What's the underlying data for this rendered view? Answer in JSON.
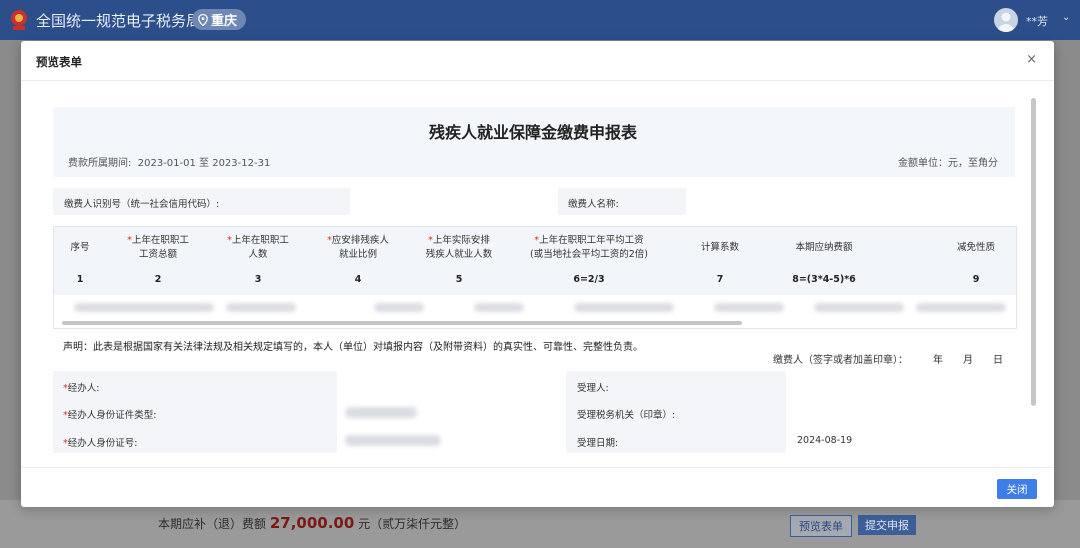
{
  "app": {
    "title": "全国统一规范电子税务局",
    "region": "重庆",
    "user": "**芳"
  },
  "footer": {
    "prefix": "本期应补（退）费额",
    "amount": "27,000.00",
    "suffix": "元（贰万柒仟元整）",
    "preview_button": "预览表单",
    "submit_button": "提交申报"
  },
  "modal": {
    "title": "预览表单",
    "close_button": "关闭",
    "form": {
      "title": "残疾人就业保障金缴费申报表",
      "period_label": "费款所属期间:",
      "period_value": "2023-01-01 至 2023-12-31",
      "unit": "金额单位：元，至角分",
      "payer_id_label": "缴费人识别号（统一社会信用代码）:",
      "payer_name_label": "缴费人名称:",
      "table": {
        "headers": [
          {
            "line1": "序号",
            "line2": "",
            "required": false
          },
          {
            "line1": "上年在职职工",
            "line2": "工资总额",
            "required": true
          },
          {
            "line1": "上年在职职工",
            "line2": "人数",
            "required": true
          },
          {
            "line1": "应安排残疾人",
            "line2": "就业比例",
            "required": true
          },
          {
            "line1": "上年实际安排",
            "line2": "残疾人就业人数",
            "required": true
          },
          {
            "line1": "上年在职职工年平均工资",
            "line2": "(或当地社会平均工资的2倍)",
            "required": true
          },
          {
            "line1": "计算系数",
            "line2": "",
            "required": false
          },
          {
            "line1": "本期应纳费额",
            "line2": "",
            "required": false
          },
          {
            "line1": "减免性质",
            "line2": "",
            "required": false
          }
        ],
        "numbers": [
          "1",
          "2",
          "3",
          "4",
          "5",
          "6=2/3",
          "7",
          "8=(3*4-5)*6",
          "9"
        ]
      },
      "declaration": "声明：此表是根据国家有关法律法规及相关规定填写的，本人（单位）对填报内容（及附带资料）的真实性、可靠性、完整性负责。",
      "sign": {
        "label": "缴费人（签字或者加盖印章）：",
        "year": "年",
        "month": "月",
        "day": "日"
      },
      "left_fields": [
        {
          "label": "经办人:",
          "required": true
        },
        {
          "label": "经办人身份证件类型:",
          "required": true
        },
        {
          "label": "经办人身份证号:",
          "required": true
        }
      ],
      "right_fields": [
        {
          "label": "受理人:"
        },
        {
          "label": "受理税务机关（印章）:"
        },
        {
          "label": "受理日期:",
          "value": "2024-08-19"
        }
      ]
    }
  },
  "colors": {
    "topbar": "#2c4f8c",
    "primary_button": "#3f7ee8",
    "required_mark": "#d9302a",
    "amount": "#7a1a12"
  }
}
